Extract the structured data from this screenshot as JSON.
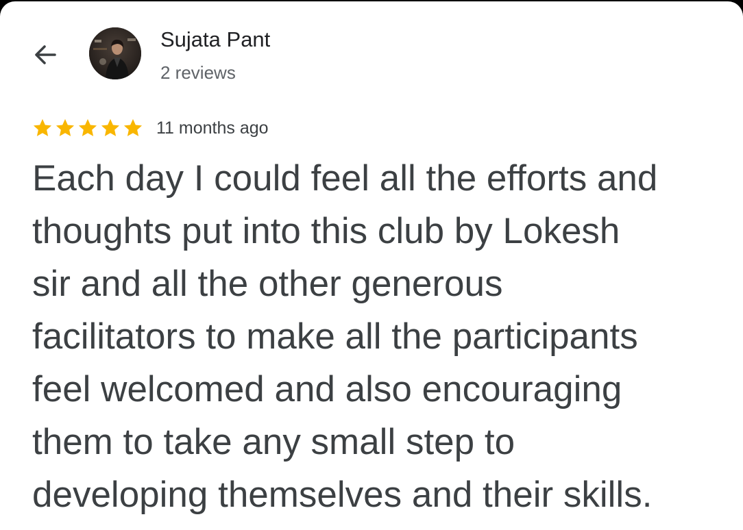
{
  "reviewer": {
    "name": "Sujata Pant",
    "review_count": "2 reviews",
    "avatar_icon": "profile-photo"
  },
  "back_icon": "arrow-left-icon",
  "rating": {
    "stars": 5,
    "max_stars": 5,
    "star_color": "#F9B600",
    "date": "11 months ago"
  },
  "review": {
    "lines": [
      "Each day I could feel all the efforts and",
      "thoughts put into this club by Lokesh",
      "sir and all the other generous",
      "facilitators to make all the participants",
      "feel welcomed and also encouraging",
      "them to take any small step to",
      "developing themselves and their skills."
    ]
  }
}
